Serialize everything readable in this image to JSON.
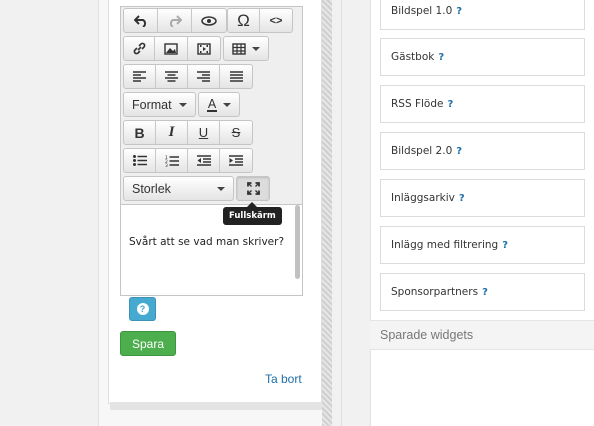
{
  "editor": {
    "toolbar": {
      "format_label": "Format",
      "textcolor_label": "A",
      "size_label": "Storlek",
      "omega_symbol": "Ω",
      "code_symbol": "<>"
    },
    "content_text": "Svårt att se vad man skriver?",
    "tooltip": "Fullskärm"
  },
  "help_button": {
    "label": "?"
  },
  "save_button": {
    "label": "Spara"
  },
  "delete_link": {
    "label": "Ta bort"
  },
  "widgets": [
    {
      "label": "Bildspel 1.0",
      "help": "?"
    },
    {
      "label": "Gästbok",
      "help": "?"
    },
    {
      "label": "RSS Flöde",
      "help": "?"
    },
    {
      "label": "Bildspel 2.0",
      "help": "?"
    },
    {
      "label": "Inläggsarkiv",
      "help": "?"
    },
    {
      "label": "Inlägg med filtrering",
      "help": "?"
    },
    {
      "label": "Sponsorpartners",
      "help": "?"
    }
  ],
  "saved_widgets_header": "Sparade widgets",
  "colors": {
    "save_green": "#4cae4c",
    "help_blue": "#46a9cf",
    "link_blue": "#1f6fa8",
    "tooltip_bg": "#222222"
  }
}
